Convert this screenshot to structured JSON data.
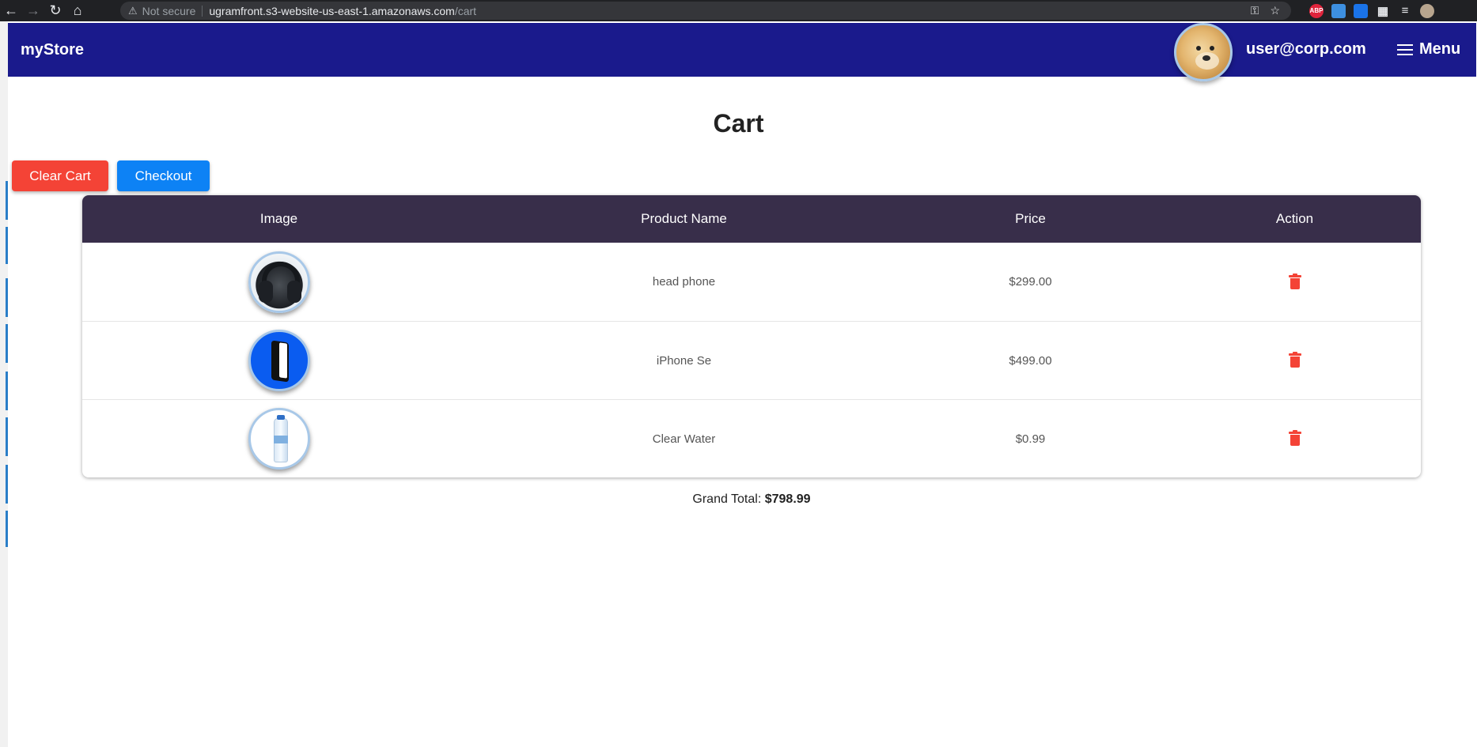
{
  "browser": {
    "security_label": "Not secure",
    "url_host": "ugramfront.s3-website-us-east-1.amazonaws.com",
    "url_path": "/cart",
    "extension_abp": "ABP"
  },
  "header": {
    "brand": "myStore",
    "user_email": "user@corp.com",
    "menu_label": "Menu"
  },
  "page": {
    "title": "Cart"
  },
  "actions": {
    "clear_cart": "Clear Cart",
    "checkout": "Checkout"
  },
  "table": {
    "columns": [
      "Image",
      "Product Name",
      "Price",
      "Action"
    ],
    "rows": [
      {
        "image_icon": "headphone-image",
        "name": "head phone",
        "price": "$299.00"
      },
      {
        "image_icon": "iphone-image",
        "name": "iPhone Se",
        "price": "$499.00"
      },
      {
        "image_icon": "water-bottle-image",
        "name": "Clear Water",
        "price": "$0.99"
      }
    ]
  },
  "summary": {
    "grand_total_label": "Grand Total:",
    "grand_total_value": "$798.99"
  },
  "colors": {
    "header_bg": "#1a1a8c",
    "table_header_bg": "#382e4a",
    "danger": "#f44336",
    "primary": "#0d82f5"
  }
}
